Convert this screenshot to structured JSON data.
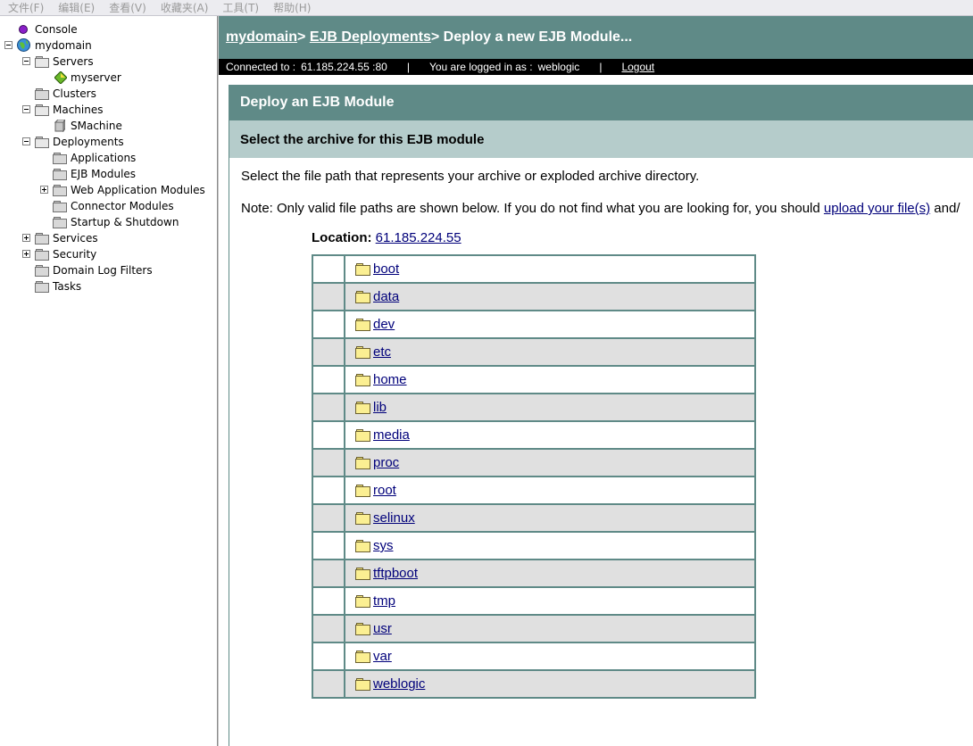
{
  "menu": [
    "文件(F)",
    "编辑(E)",
    "查看(V)",
    "收藏夹(A)",
    "工具(T)",
    "帮助(H)"
  ],
  "tree": {
    "console": "Console",
    "domain": "mydomain",
    "servers": "Servers",
    "myserver": "myserver",
    "clusters": "Clusters",
    "machines": "Machines",
    "smachine": "SMachine",
    "deployments": "Deployments",
    "applications": "Applications",
    "ejb_modules": "EJB Modules",
    "web_app_modules": "Web Application Modules",
    "connector_modules": "Connector Modules",
    "startup_shutdown": "Startup & Shutdown",
    "services": "Services",
    "security": "Security",
    "domain_log_filters": "Domain Log Filters",
    "tasks": "Tasks"
  },
  "header": {
    "crumb_domain": "mydomain",
    "sep1": "> ",
    "crumb_ejb": "EJB Deployments",
    "sep2": "> ",
    "current": "Deploy a new EJB Module..."
  },
  "status": {
    "connected_label": "Connected to :",
    "connected_value": "61.185.224.55 :80",
    "divider": "|",
    "logged_label": "You are logged in as :",
    "logged_value": "weblogic",
    "logout": "Logout"
  },
  "panel": {
    "title": "Deploy an EJB Module",
    "subtitle": "Select the archive for this EJB module",
    "instructions": "Select the file path that represents your archive or exploded archive directory.",
    "note_prefix": "Note: Only valid file paths are shown below. If you do not find what you are looking for, you should ",
    "note_link": "upload your file(s)",
    "note_suffix": " and/",
    "location_label": "Location:",
    "location_value": "61.185.224.55"
  },
  "folders": [
    "boot",
    "data",
    "dev",
    "etc",
    "home",
    "lib",
    "media",
    "proc",
    "root",
    "selinux",
    "sys",
    "tftpboot",
    "tmp",
    "usr",
    "var",
    "weblogic"
  ],
  "colors": {
    "header_teal": "#5f8a87",
    "subheader": "#b5cccb",
    "row_alt": "#e0e0e0",
    "link": "#00007a"
  }
}
